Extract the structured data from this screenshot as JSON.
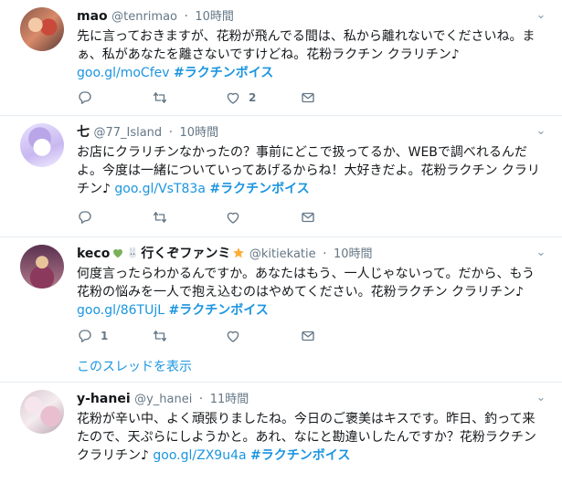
{
  "tweets": [
    {
      "name": "mao",
      "handle": "@tenrimao",
      "time": "10時間",
      "text": "先に言っておきますが、花粉が飛んでる間は、私から離れないでくださいね。まぁ、私があなたを離さないですけどね。花粉ラクチン クラリチン♪",
      "link": "goo.gl/moCfev",
      "hashtag": "#ラクチンボイス",
      "likes": "2"
    },
    {
      "name": "七",
      "handle": "@77_Island",
      "time": "10時間",
      "text": "お店にクラリチンなかったの？事前にどこで扱ってるか、WEBで調べれるんだよ。今度は一緒についていってあげるからね！大好きだよ。花粉ラクチン クラリチン♪",
      "link": "goo.gl/VsT83a",
      "hashtag": "#ラクチンボイス"
    },
    {
      "name_prefix": "keco",
      "name_middle": "行くぞファンミ",
      "handle": "@kitiekatie",
      "time": "10時間",
      "text": "何度言ったらわかるんですか。あなたはもう、一人じゃないって。だから、もう花粉の悩みを一人で抱え込むのはやめてください。花粉ラクチン クラリチン♪",
      "link": "goo.gl/86TUjL",
      "hashtag": "#ラクチンボイス",
      "replies": "1",
      "thread_label": "このスレッドを表示"
    },
    {
      "name": "y-hanei",
      "handle": "@y_hanei",
      "time": "11時間",
      "text": "花粉が辛い中、よく頑張りましたね。今日のご褒美はキスです。昨日、釣って来たので、天ぷらにしようかと。あれ、なにと勘違いしたんですか？花粉ラクチン クラリチン♪",
      "link": "goo.gl/ZX9u4a",
      "hashtag": "#ラクチンボイス"
    }
  ],
  "icons": {
    "reply": "reply-icon",
    "retweet": "retweet-icon",
    "like": "heart-icon",
    "dm": "envelope-icon",
    "caret": "chevron-down-icon"
  },
  "colors": {
    "link": "#1b95e0",
    "muted": "#657786",
    "text": "#14171a",
    "divider": "#e6ecf0"
  }
}
